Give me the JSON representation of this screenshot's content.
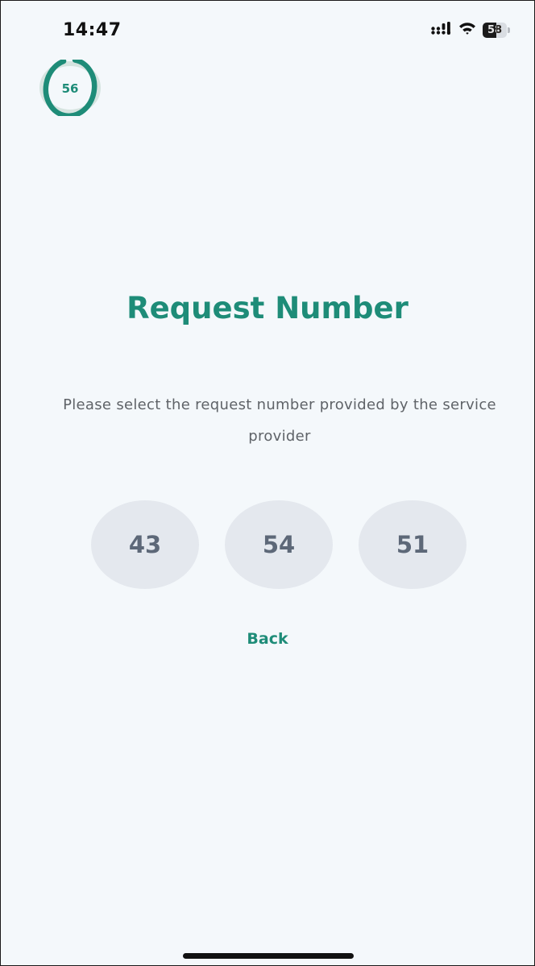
{
  "status_bar": {
    "time": "14:47",
    "battery_level": "58",
    "signal_icon": "cellular-signal-icon",
    "wifi_icon": "wifi-icon"
  },
  "timer": {
    "value": "56",
    "progress_fraction": 0.93,
    "color": "#1e8c78"
  },
  "main": {
    "title": "Request Number",
    "instruction": "Please select the request number provided by the service provider",
    "choices": [
      "43",
      "54",
      "51"
    ],
    "back_label": "Back"
  },
  "colors": {
    "accent": "#1e8c78",
    "background": "#f4f8fb",
    "choice_bg": "#e4e8ee",
    "choice_text": "#5d6878"
  }
}
